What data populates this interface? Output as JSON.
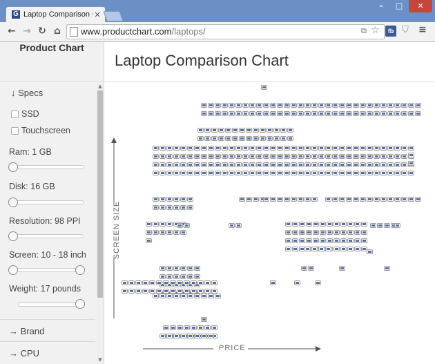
{
  "browser": {
    "tab_title": "Laptop Comparison Cha",
    "tab_favicon": "G",
    "close_glyph": "×",
    "url_domain": "www.productchart.com",
    "url_path": "/laptops/",
    "fb_label": "fb"
  },
  "sidebar": {
    "brand": "Product Chart",
    "specs": "↓ Specs",
    "ssd": "SSD",
    "touchscreen": "Touchscreen",
    "ram": "Ram: 1 GB",
    "disk": "Disk: 16 GB",
    "resolution": "Resolution: 98 PPI",
    "screen": "Screen: 10 - 18 inch",
    "weight": "Weight: 17 pounds",
    "brand_filter": "→ Brand",
    "cpu_filter": "→ CPU"
  },
  "main": {
    "title": "Laptop Comparison Chart",
    "y_label": "SCREEN SIZE",
    "x_label": "PRICE"
  },
  "colors": {
    "chrome": "#6b90c6",
    "laptop_screen": "#5a6c9a",
    "close_button": "#c7463a"
  },
  "icons": [
    "favicon-icon",
    "close-icon",
    "back-icon",
    "forward-icon",
    "reload-icon",
    "home-icon",
    "page-icon",
    "translate-icon",
    "star-icon",
    "facebook-icon",
    "shield-icon",
    "menu-icon",
    "laptop-thumbnail-icon"
  ]
}
